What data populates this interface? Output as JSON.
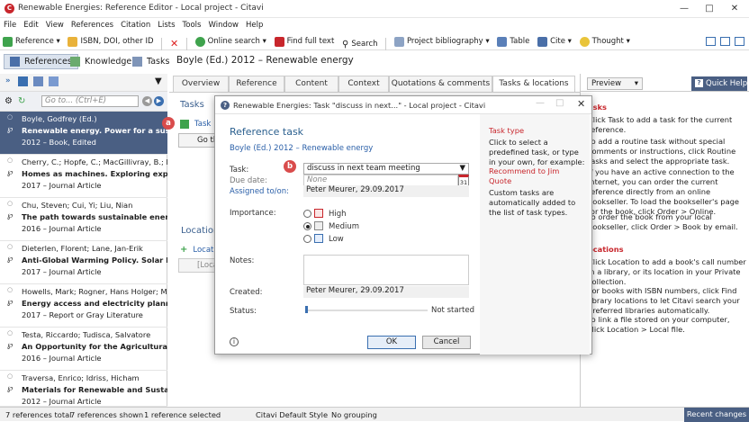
{
  "window": {
    "title": "Renewable Energies: Reference Editor - Local project - Citavi"
  },
  "menu": [
    "File",
    "Edit",
    "View",
    "References",
    "Citation",
    "Lists",
    "Tools",
    "Window",
    "Help"
  ],
  "toolbar": {
    "reference": "Reference",
    "isbn": "ISBN, DOI, other ID",
    "online_search": "Online search",
    "find_full_text": "Find full text",
    "search": "Search",
    "project_bibliography": "Project bibliography",
    "table": "Table",
    "cite": "Cite",
    "thought": "Thought"
  },
  "nav": {
    "references": "References",
    "knowledge": "Knowledge",
    "tasks": "Tasks"
  },
  "search": {
    "placeholder": "Go to... (Ctrl+E)"
  },
  "references": [
    {
      "authors": "Boyle, Godfrey (Ed.)",
      "title": "Renewable energy. Power for a sustainable f",
      "meta": "2012 – Book, Edited",
      "selected": true
    },
    {
      "authors": "Cherry, C.; Hopfe, C.; MacGillivray, B.; Pidgeo",
      "title": "Homes as machines. Exploring expert and p",
      "meta": "2017 – Journal Article",
      "selected": false
    },
    {
      "authors": "Chu, Steven; Cui, Yi; Liu, Nian",
      "title": "The path towards sustainable energy",
      "meta": "2016 – Journal Article",
      "selected": false
    },
    {
      "authors": "Dieterlen, Florent; Lane, Jan-Erik",
      "title": "Anti-Global Warming Policy. Solar Power Par",
      "meta": "2017 – Journal Article",
      "selected": false
    },
    {
      "authors": "Howells, Mark; Rogner, Hans Holger; Mentis,",
      "title": "Energy access and electricity planning",
      "meta": "2017 – Report or Gray Literature",
      "selected": false
    },
    {
      "authors": "Testa, Riccardo; Tudisca, Salvatore",
      "title": "An Opportunity for the Agricultural Sector.",
      "meta": "2016 – Journal Article",
      "selected": false
    },
    {
      "authors": "Traversa, Enrico; Idriss, Hicham",
      "title": "Materials for Renewable and Sustainable En",
      "meta": "2012 – Journal Article",
      "selected": false
    }
  ],
  "editor": {
    "header": "Boyle (Ed.) 2012 – Renewable energy",
    "tabs": [
      "Overview",
      "Reference",
      "Content",
      "Context",
      "Quotations & comments",
      "Tasks & locations"
    ],
    "tasks_label": "Tasks",
    "task_link": "Task",
    "goto_label": "Go th",
    "locations_label": "Location",
    "location_link": "Locatio",
    "loc_field": "[Loca"
  },
  "badges": {
    "a": "a",
    "b": "b"
  },
  "help": {
    "preview_label": "Preview",
    "quick_help": "Quick Help",
    "tasks_head": "asks",
    "t1": "Click Task to add a task for the current reference.",
    "t2": "To add a routine task without special comments or instructions, click Routine tasks and select the appropriate task.",
    "t3": "If you have an active connection to the internet, you can order the current reference directly from an online bookseller. To load the bookseller's page for the book, click Order > Online.",
    "t4": "To order the book from your local bookseller, click Order > Book by email.",
    "loc_head": "ocations",
    "l1": "Click Location to add a book's call number in a library, or its location in your Private collection.",
    "l2": "For books with ISBN numbers, click Find library locations to let Citavi search your preferred libraries automatically.",
    "l3": "To link a file stored on your computer, click Location > Local file."
  },
  "dialog": {
    "title": "Renewable Energies: Task \"discuss in next...\" - Local project - Citavi",
    "heading": "Reference task",
    "ref_link": "Boyle (Ed.) 2012 – Renewable energy",
    "task_label": "Task:",
    "task_value": "discuss in next team meeting",
    "due_label": "Due date:",
    "due_value": "None",
    "calendar_day": "31",
    "assigned_label": "Assigned to/on:",
    "assigned_value": "Peter Meurer, 29.09.2017",
    "importance_label": "Importance:",
    "imp_high": "High",
    "imp_medium": "Medium",
    "imp_low": "Low",
    "notes_label": "Notes:",
    "created_label": "Created:",
    "created_value": "Peter Meurer, 29.09.2017",
    "status_label": "Status:",
    "status_value": "Not started",
    "ok": "OK",
    "cancel": "Cancel",
    "side_head": "Task type",
    "side1": "Click to select a predefined task, or type in your own, for example:",
    "side_link": "Recommend to Jim Quote",
    "side2": "Custom tasks are automatically added to the list of task types."
  },
  "status": {
    "refs_total": "7 references total",
    "refs_shown": "7 references shown",
    "refs_selected": "1 reference selected",
    "style": "Citavi Default Style",
    "grouping": "No grouping",
    "recent": "Recent changes"
  }
}
